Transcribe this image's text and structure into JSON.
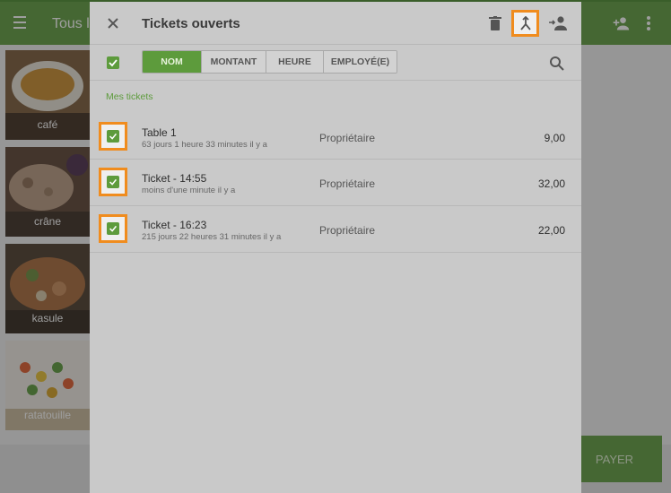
{
  "background": {
    "title": "Tous l",
    "tiles": [
      {
        "name": "café"
      },
      {
        "name": "crâne"
      },
      {
        "name": "kasule"
      },
      {
        "name": "ratatouille"
      }
    ],
    "pay_label": "PAYER"
  },
  "dialog": {
    "title": "Tickets ouverts",
    "filters": [
      "NOM",
      "MONTANT",
      "HEURE",
      "EMPLOYÉ(E)"
    ],
    "section_label": "Mes tickets",
    "tickets": [
      {
        "name": "Table 1",
        "time": "63 jours 1 heure 33 minutes  il y a",
        "owner": "Propriétaire",
        "amount": "9,00"
      },
      {
        "name": "Ticket - 14:55",
        "time": "moins d'une minute il y a",
        "owner": "Propriétaire",
        "amount": "32,00"
      },
      {
        "name": "Ticket - 16:23",
        "time": "215 jours 22 heures 31 minutes  il y a",
        "owner": "Propriétaire",
        "amount": "22,00"
      }
    ]
  },
  "colors": {
    "accent": "#5d9b3c",
    "highlight": "#f08c1e"
  },
  "icons": [
    "menu-icon",
    "close-icon",
    "trash-icon",
    "merge-icon",
    "assign-user-icon",
    "search-icon",
    "checkbox-checked-icon",
    "add-user-icon",
    "more-vert-icon"
  ]
}
